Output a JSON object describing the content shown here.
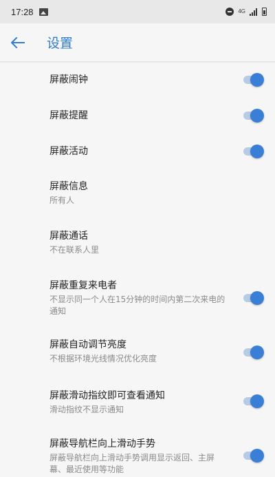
{
  "status_bar": {
    "time": "17:28",
    "network": "4G",
    "icons": [
      "image-icon",
      "do-not-disturb-icon",
      "signal-icon",
      "battery-icon"
    ]
  },
  "app_bar": {
    "title": "设置",
    "back_icon": "arrow-left-icon"
  },
  "colors": {
    "accent": "#2f7bd6",
    "toggle_thumb": "#3a7fd6",
    "toggle_track": "#b6cbe6",
    "background": "#f6f6f6",
    "status_bar": "#e8e8e8"
  },
  "settings": [
    {
      "title": "屏蔽闹钟",
      "summary": "",
      "toggle": true,
      "checked": true
    },
    {
      "title": "屏蔽提醒",
      "summary": "",
      "toggle": true,
      "checked": true
    },
    {
      "title": "屏蔽活动",
      "summary": "",
      "toggle": true,
      "checked": true
    },
    {
      "title": "屏蔽信息",
      "summary": "所有人",
      "toggle": false
    },
    {
      "title": "屏蔽通话",
      "summary": "不在联系人里",
      "toggle": false
    },
    {
      "title": "屏蔽重复来电者",
      "summary": "不显示同一个人在15分钟的时间内第二次来电的通知",
      "toggle": true,
      "checked": true
    },
    {
      "title": "屏蔽自动调节亮度",
      "summary": "不根据环境光线情况优化亮度",
      "toggle": true,
      "checked": true
    },
    {
      "title": "屏蔽滑动指纹即可查看通知",
      "summary": "滑动指纹不显示通知",
      "toggle": true,
      "checked": true
    },
    {
      "title": "屏蔽导航栏向上滑动手势",
      "summary": "屏蔽导航栏向上滑动手势调用显示返回、主屏幕、最近使用等功能",
      "toggle": true,
      "checked": true
    }
  ]
}
